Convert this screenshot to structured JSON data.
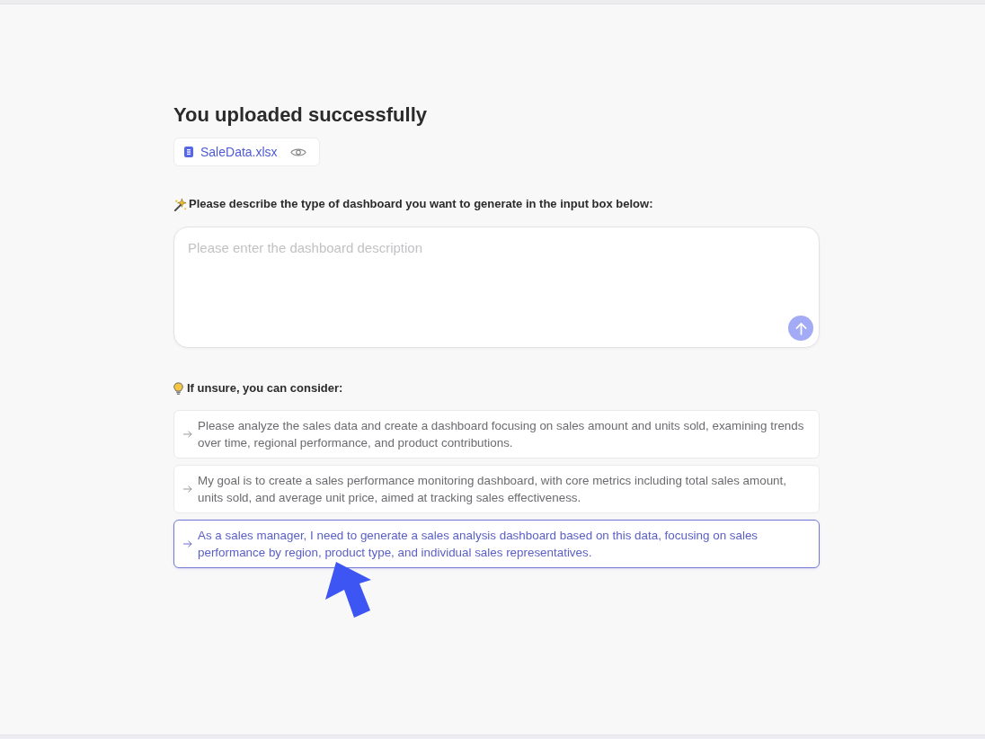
{
  "upload": {
    "title": "You uploaded successfully",
    "file": {
      "name": "SaleData.xlsx"
    }
  },
  "prompt": {
    "label": "Please describe the type of dashboard you want to generate in the input box below:",
    "placeholder": "Please enter the dashboard description",
    "send_button": {
      "disabled": true
    }
  },
  "suggestions": {
    "heading": "If unsure, you can consider:",
    "items": [
      {
        "text": "Please analyze the sales data and create a dashboard focusing on sales amount and units sold, examining trends over time, regional performance, and product contributions.",
        "selected": false
      },
      {
        "text": "My goal is to create a sales performance monitoring dashboard, with core metrics including total sales amount, units sold, and average unit price, aimed at tracking sales effectiveness.",
        "selected": false
      },
      {
        "text": "As a sales manager, I need to generate a sales analysis dashboard based on this data, focusing on sales performance by region, product type, and individual sales representatives.",
        "selected": true
      }
    ]
  }
}
